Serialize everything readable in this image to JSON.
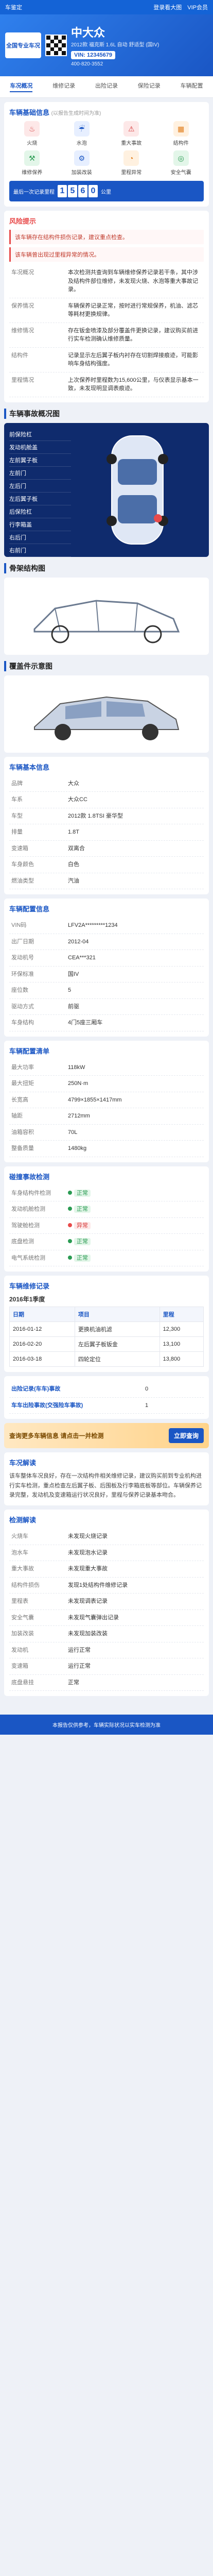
{
  "topbar": {
    "brand": "车鉴定",
    "links": [
      "登录看大图",
      "VIP会员"
    ]
  },
  "header": {
    "logo": "全国专业车况",
    "title": "中大众",
    "subtitle": "2012款 福克斯 1.6L 自动 舒适型 (国IV)",
    "plate": "VIN: 12345679",
    "phone": "400-820-3552"
  },
  "nav": [
    "车况概况",
    "维修记录",
    "出险记录",
    "保险记录",
    "车辆配置"
  ],
  "overview": {
    "title": "车辆基础信息",
    "note": "(以报告生成时间为准)",
    "icons": [
      {
        "name": "火烧",
        "icon": "fire-icon",
        "cls": "red"
      },
      {
        "name": "水泡",
        "icon": "water-icon",
        "cls": ""
      },
      {
        "name": "重大事故",
        "icon": "crash-icon",
        "cls": "red"
      },
      {
        "name": "结构件",
        "icon": "frame-icon",
        "cls": "orange"
      },
      {
        "name": "维修保养",
        "icon": "wrench-icon",
        "cls": "green"
      },
      {
        "name": "加装改装",
        "icon": "gear-icon",
        "cls": ""
      },
      {
        "name": "里程异常",
        "icon": "gauge-icon",
        "cls": "orange"
      },
      {
        "name": "安全气囊",
        "icon": "airbag-icon",
        "cls": "green"
      }
    ],
    "mileage_label": "最后一次记录里程",
    "mileage_digits": [
      "1",
      "5",
      "6",
      "0"
    ],
    "mileage_unit": "公里"
  },
  "warnings": {
    "title": "风险提示",
    "items": [
      "该车辆存在结构件损伤记录，建议重点检查。",
      "该车辆曾出现过里程异常的情况。"
    ]
  },
  "report_rows": [
    {
      "k": "车况概况",
      "v": "本次检测共查询到车辆维修保养记录若干条，其中涉及结构件部位维修，未发现火烧、水泡等重大事故记录。"
    },
    {
      "k": "保养情况",
      "v": "车辆保养记录正常，按时进行常规保养，机油、滤芯等耗材更换规律。"
    },
    {
      "k": "维修情况",
      "v": "存在钣金喷漆及部分覆盖件更换记录，建议购买前进行实车检测确认维修质量。"
    },
    {
      "k": "结构件",
      "v": "记录显示左后翼子板内衬存在切割焊接痕迹，可能影响车身结构强度。"
    },
    {
      "k": "里程情况",
      "v": "上次保养时里程数为15,600公里，与仪表显示基本一致，未发现明显调表痕迹。"
    }
  ],
  "diagram": {
    "title": "车辆事故概况图",
    "items": [
      "前保险杠",
      "发动机舱盖",
      "左前翼子板",
      "左前门",
      "左后门",
      "左后翼子板",
      "后保险杠",
      "行李箱盖",
      "右后门",
      "右前门"
    ]
  },
  "structure": {
    "title": "骨架结构图"
  },
  "parts": {
    "title": "覆盖件示意图"
  },
  "basic": {
    "title": "车辆基本信息",
    "rows": [
      {
        "k": "品牌",
        "v": "大众"
      },
      {
        "k": "车系",
        "v": "大众CC"
      },
      {
        "k": "车型",
        "v": "2012款 1.8TSI 豪华型"
      },
      {
        "k": "排量",
        "v": "1.8T"
      },
      {
        "k": "变速箱",
        "v": "双离合"
      },
      {
        "k": "车身颜色",
        "v": "白色"
      },
      {
        "k": "燃油类型",
        "v": "汽油"
      }
    ]
  },
  "detail": {
    "title": "车辆配置信息",
    "rows": [
      {
        "k": "VIN码",
        "v": "LFV2A*********1234"
      },
      {
        "k": "出厂日期",
        "v": "2012-04"
      },
      {
        "k": "发动机号",
        "v": "CEA***321"
      },
      {
        "k": "环保标准",
        "v": "国IV"
      },
      {
        "k": "座位数",
        "v": "5"
      },
      {
        "k": "驱动方式",
        "v": "前驱"
      },
      {
        "k": "车身结构",
        "v": "4门5座三厢车"
      }
    ]
  },
  "config": {
    "title": "车辆配置清单",
    "rows": [
      {
        "k": "最大功率",
        "v": "118kW"
      },
      {
        "k": "最大扭矩",
        "v": "250N·m"
      },
      {
        "k": "长宽高",
        "v": "4799×1855×1417mm"
      },
      {
        "k": "轴距",
        "v": "2712mm"
      },
      {
        "k": "油箱容积",
        "v": "70L"
      },
      {
        "k": "整备质量",
        "v": "1480kg"
      }
    ]
  },
  "safety": {
    "title": "碰撞事故检测",
    "rows": [
      {
        "k": "车身结构件检测",
        "ok": true,
        "text": "正常"
      },
      {
        "k": "发动机舱检测",
        "ok": true,
        "text": "正常"
      },
      {
        "k": "驾驶舱检测",
        "ok": false,
        "text": "异常"
      },
      {
        "k": "底盘检测",
        "ok": true,
        "text": "正常"
      },
      {
        "k": "电气系统检测",
        "ok": true,
        "text": "正常"
      }
    ]
  },
  "history": {
    "title": "车辆维修记录",
    "year": "2016年1季度",
    "cols": [
      "日期",
      "项目",
      "里程"
    ],
    "rows": [
      [
        "2016-01-12",
        "更换机油机滤",
        "12,300"
      ],
      [
        "2016-02-20",
        "左后翼子板钣金",
        "13,100"
      ],
      [
        "2016-03-18",
        "四轮定位",
        "13,800"
      ]
    ]
  },
  "insurance": {
    "title": "出险记录(车车)事故",
    "count": "0"
  },
  "claims": {
    "title": "车车出险事故(交强险车事故)",
    "count": "1"
  },
  "promo": {
    "text": "查询更多车辆信息 请点击一并检测",
    "button": "立即查询"
  },
  "summary": {
    "title": "车况解读",
    "para": "该车整体车况良好，存在一次结构件相关维修记录，建议购买前到专业机构进行实车检测，重点检查左后翼子板、后围板及行李箱底板等部位。车辆保养记录完整，发动机及变速箱运行状况良好，里程与保养记录基本吻合。"
  },
  "analysis": {
    "title": "检测解读",
    "items": [
      {
        "k": "火烧车",
        "v": "未发现火烧记录"
      },
      {
        "k": "泡水车",
        "v": "未发现泡水记录"
      },
      {
        "k": "重大事故",
        "v": "未发现重大事故"
      },
      {
        "k": "结构件损伤",
        "v": "发现1处结构件维修记录"
      },
      {
        "k": "里程表",
        "v": "未发现调表记录"
      },
      {
        "k": "安全气囊",
        "v": "未发现气囊弹出记录"
      },
      {
        "k": "加装改装",
        "v": "未发现加装改装"
      },
      {
        "k": "发动机",
        "v": "运行正常"
      },
      {
        "k": "变速箱",
        "v": "运行正常"
      },
      {
        "k": "底盘悬挂",
        "v": "正常"
      }
    ]
  },
  "footer": {
    "text": "本报告仅供参考，车辆实际状况以实车检测为准"
  }
}
